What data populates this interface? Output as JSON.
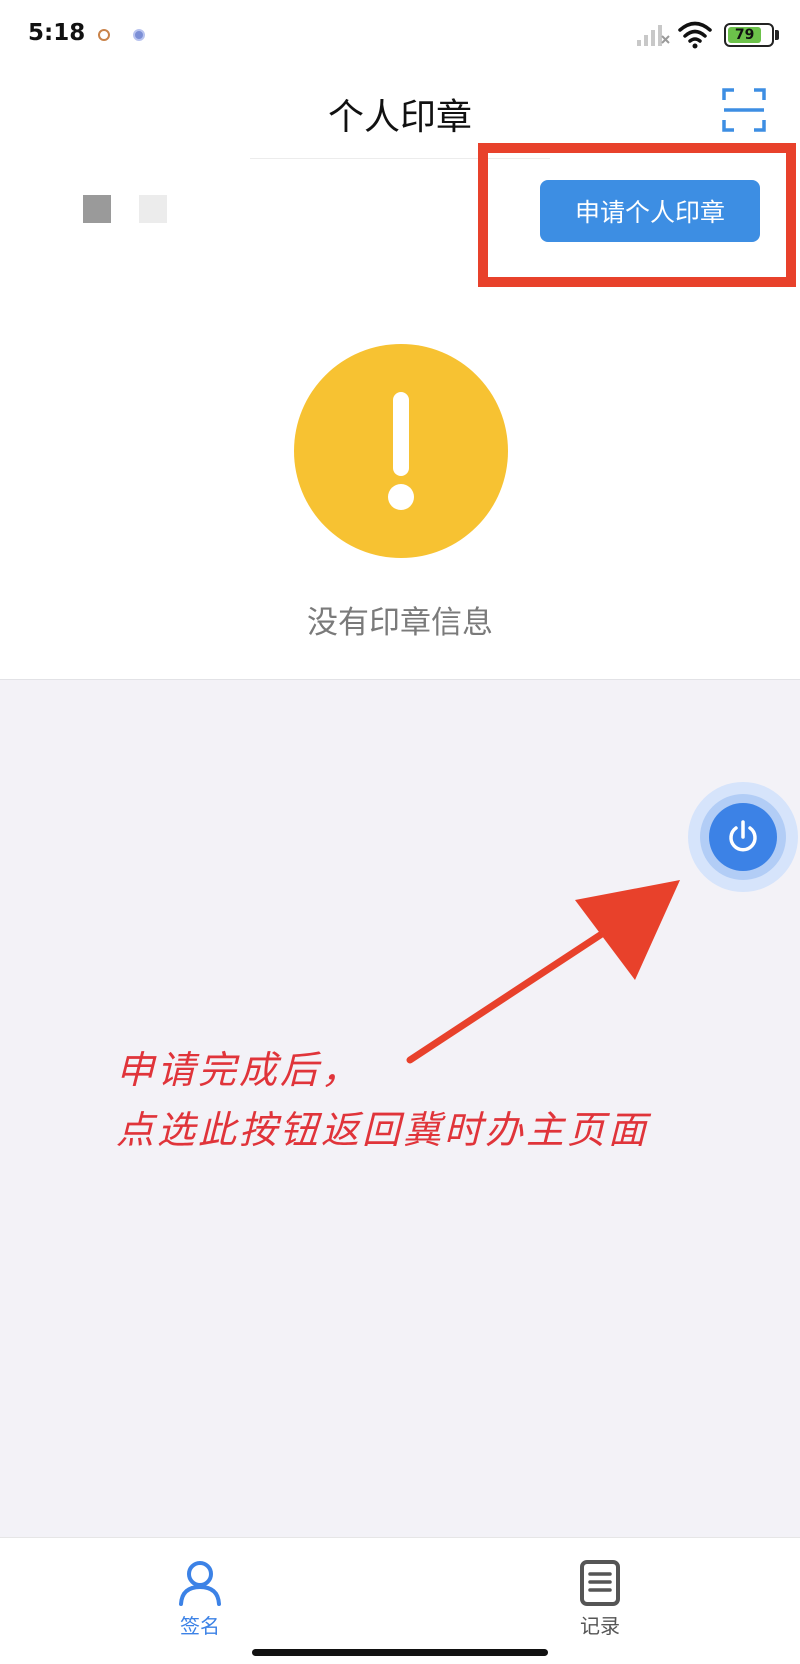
{
  "status_bar": {
    "time": "5:18",
    "battery_level": "79",
    "battery_percent": 79
  },
  "header": {
    "title": "个人印章"
  },
  "toolbar": {
    "apply_label": "申请个人印章"
  },
  "empty_state": {
    "message": "没有印章信息"
  },
  "annotation": {
    "line1": "申请完成后，",
    "line2": "点选此按钮返回冀时办主页面"
  },
  "tabs": [
    {
      "label": "签名",
      "active": true,
      "icon": "person-icon"
    },
    {
      "label": "记录",
      "active": false,
      "icon": "document-icon"
    }
  ],
  "colors": {
    "accent": "#3d8ee3",
    "warning": "#f7c232",
    "annotation": "#e0343a",
    "power_button": "#3c82e6"
  }
}
